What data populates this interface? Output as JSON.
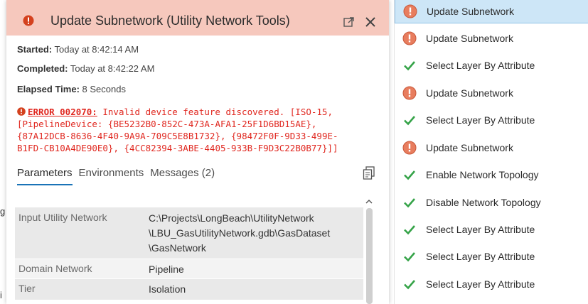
{
  "popup": {
    "title": "Update Subnetwork (Utility Network Tools)",
    "started_label": "Started:",
    "started_value": "Today at 8:42:14 AM",
    "completed_label": "Completed:",
    "completed_value": "Today at 8:42:22 AM",
    "elapsed_label": "Elapsed Time:",
    "elapsed_value": "8 Seconds",
    "error": {
      "code": "ERROR 002070:",
      "line1": "Invalid device feature discovered. [ISO-15,",
      "line2": "[PipelineDevice: {BE5232B0-852C-473A-AFA1-25F1D6BD15AE},",
      "line3": "{87A12DCB-8636-4F40-9A9A-709C5E8B1732}, {98472F0F-9D33-499E-",
      "line4": "B1FD-CB10A4DE90E0}, {4CC82394-3ABE-4405-933B-F9D3C22B0B77}]]"
    },
    "tabs": [
      "Parameters",
      "Environments",
      "Messages (2)"
    ],
    "parameters": [
      {
        "name": "Input Utility Network",
        "value_lines": [
          "C:\\Projects\\LongBeach\\UtilityNetwork",
          "\\LBU_GasUtilityNetwork.gdb\\GasDataset",
          "\\GasNetwork"
        ]
      },
      {
        "name": "Domain Network",
        "value_lines": [
          "Pipeline"
        ]
      },
      {
        "name": "Tier",
        "value_lines": [
          "Isolation"
        ]
      }
    ]
  },
  "background_fragments": [
    "g",
    "i"
  ],
  "history": {
    "items": [
      {
        "label": "Update Subnetwork",
        "status": "error",
        "selected": true
      },
      {
        "label": "Update Subnetwork",
        "status": "error",
        "selected": false
      },
      {
        "label": "Select Layer By Attribute",
        "status": "success",
        "selected": false
      },
      {
        "label": "Update Subnetwork",
        "status": "error",
        "selected": false
      },
      {
        "label": "Select Layer By Attribute",
        "status": "success",
        "selected": false
      },
      {
        "label": "Update Subnetwork",
        "status": "error",
        "selected": false
      },
      {
        "label": "Enable Network Topology",
        "status": "success",
        "selected": false
      },
      {
        "label": "Disable Network Topology",
        "status": "success",
        "selected": false
      },
      {
        "label": "Select Layer By Attribute",
        "status": "success",
        "selected": false
      },
      {
        "label": "Select Layer By Attribute",
        "status": "success",
        "selected": false
      },
      {
        "label": "Select Layer By Attribute",
        "status": "success",
        "selected": false
      }
    ]
  },
  "colors": {
    "header_bg": "#f6c8bd",
    "error_text": "#e0271f",
    "error_icon_fill": "#e87d5e",
    "success_check": "#35a348",
    "selected_row": "#cde6f7",
    "active_tab_underline": "#1a73b7"
  },
  "icons": {
    "header_status": "error-icon",
    "popout": "popout-icon",
    "close": "close-icon",
    "copy": "copy-icon",
    "success": "checkmark-icon",
    "error": "error-icon"
  }
}
